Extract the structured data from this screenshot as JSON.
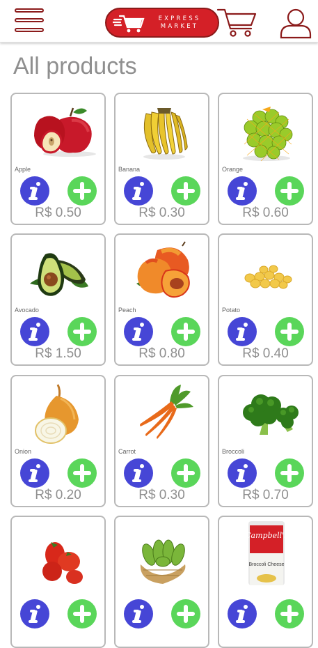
{
  "header": {
    "logo": {
      "line1": "EXPRESS",
      "line2": "MARKET"
    },
    "menu_icon": "hamburger-menu-icon",
    "cart_icon": "shopping-cart-icon",
    "account_icon": "user-account-icon"
  },
  "page": {
    "title": "All products"
  },
  "colors": {
    "brand": "#d42027",
    "brand_dark": "#8b1a1a",
    "info": "#4646d6",
    "add": "#5ad65a",
    "text_muted": "#8f8f8f",
    "card_border": "#b8b8b8"
  },
  "products": [
    {
      "name": "Apple",
      "price": "R$ 0.50",
      "image": "apple"
    },
    {
      "name": "Banana",
      "price": "R$ 0.30",
      "image": "banana"
    },
    {
      "name": "Orange",
      "price": "R$ 0.60",
      "image": "orange"
    },
    {
      "name": "Avocado",
      "price": "R$ 1.50",
      "image": "avocado"
    },
    {
      "name": "Peach",
      "price": "R$ 0.80",
      "image": "peach"
    },
    {
      "name": "Potato",
      "price": "R$ 0.40",
      "image": "potato"
    },
    {
      "name": "Onion",
      "price": "R$ 0.20",
      "image": "onion"
    },
    {
      "name": "Carrot",
      "price": "R$ 0.30",
      "image": "carrot"
    },
    {
      "name": "Broccoli",
      "price": "R$ 0.70",
      "image": "broccoli"
    },
    {
      "name": "",
      "price": "",
      "image": "tomato"
    },
    {
      "name": "",
      "price": "",
      "image": "cucumber"
    },
    {
      "name": "",
      "price": "",
      "image": "soup-can",
      "label_line1": "Campbell's",
      "label_line2": "Broccoli Cheese"
    }
  ]
}
